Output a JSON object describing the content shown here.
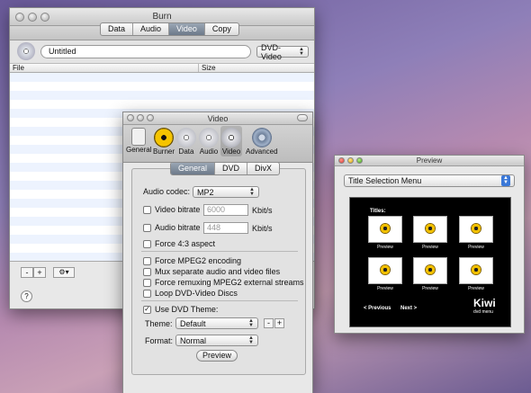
{
  "burn_window": {
    "title": "Burn",
    "tabs": [
      "Data",
      "Audio",
      "Video",
      "Copy"
    ],
    "selected_tab": "Video",
    "disc_name": "Untitled",
    "format_value": "DVD-Video",
    "columns": [
      "File",
      "Size"
    ],
    "remove_label": "-",
    "add_label": "+",
    "action_label": "⚙▾",
    "help_label": "?"
  },
  "video_window": {
    "title": "Video",
    "toolbar": [
      "General",
      "Burner",
      "Data",
      "Audio",
      "Video",
      "Advanced"
    ],
    "subtabs": [
      "General",
      "DVD",
      "DivX"
    ],
    "selected_subtab": "General",
    "audio_codec_label": "Audio codec:",
    "audio_codec_value": "MP2",
    "video_bitrate_label": "Video bitrate",
    "video_bitrate_value": "6000",
    "audio_bitrate_label": "Audio bitrate",
    "audio_bitrate_value": "448",
    "unit": "Kbit/s",
    "force43": "Force 4:3 aspect",
    "force_mpeg2": "Force MPEG2 encoding",
    "mux": "Mux separate audio and video files",
    "remux": "Force remuxing MPEG2 external streams",
    "loop": "Loop DVD-Video Discs",
    "use_theme": "Use DVD Theme:",
    "use_theme_checked": "✓",
    "theme_label": "Theme:",
    "theme_value": "Default",
    "theme_minus": "-",
    "theme_plus": "+",
    "format_label": "Format:",
    "format_value": "Normal",
    "preview_button": "Preview"
  },
  "preview_window": {
    "title": "Preview",
    "menu_value": "Title Selection Menu",
    "titles_label": "Titles:",
    "thumb_caption": "Preview",
    "prev_label": "< Previous",
    "next_label": "Next >",
    "brand": "Kiwi",
    "brand_sub": "dvd menu"
  },
  "colors": {
    "selected_tab": "#7d8a99",
    "desktop": "#8e7fb8",
    "theme_bg": "#000000"
  }
}
